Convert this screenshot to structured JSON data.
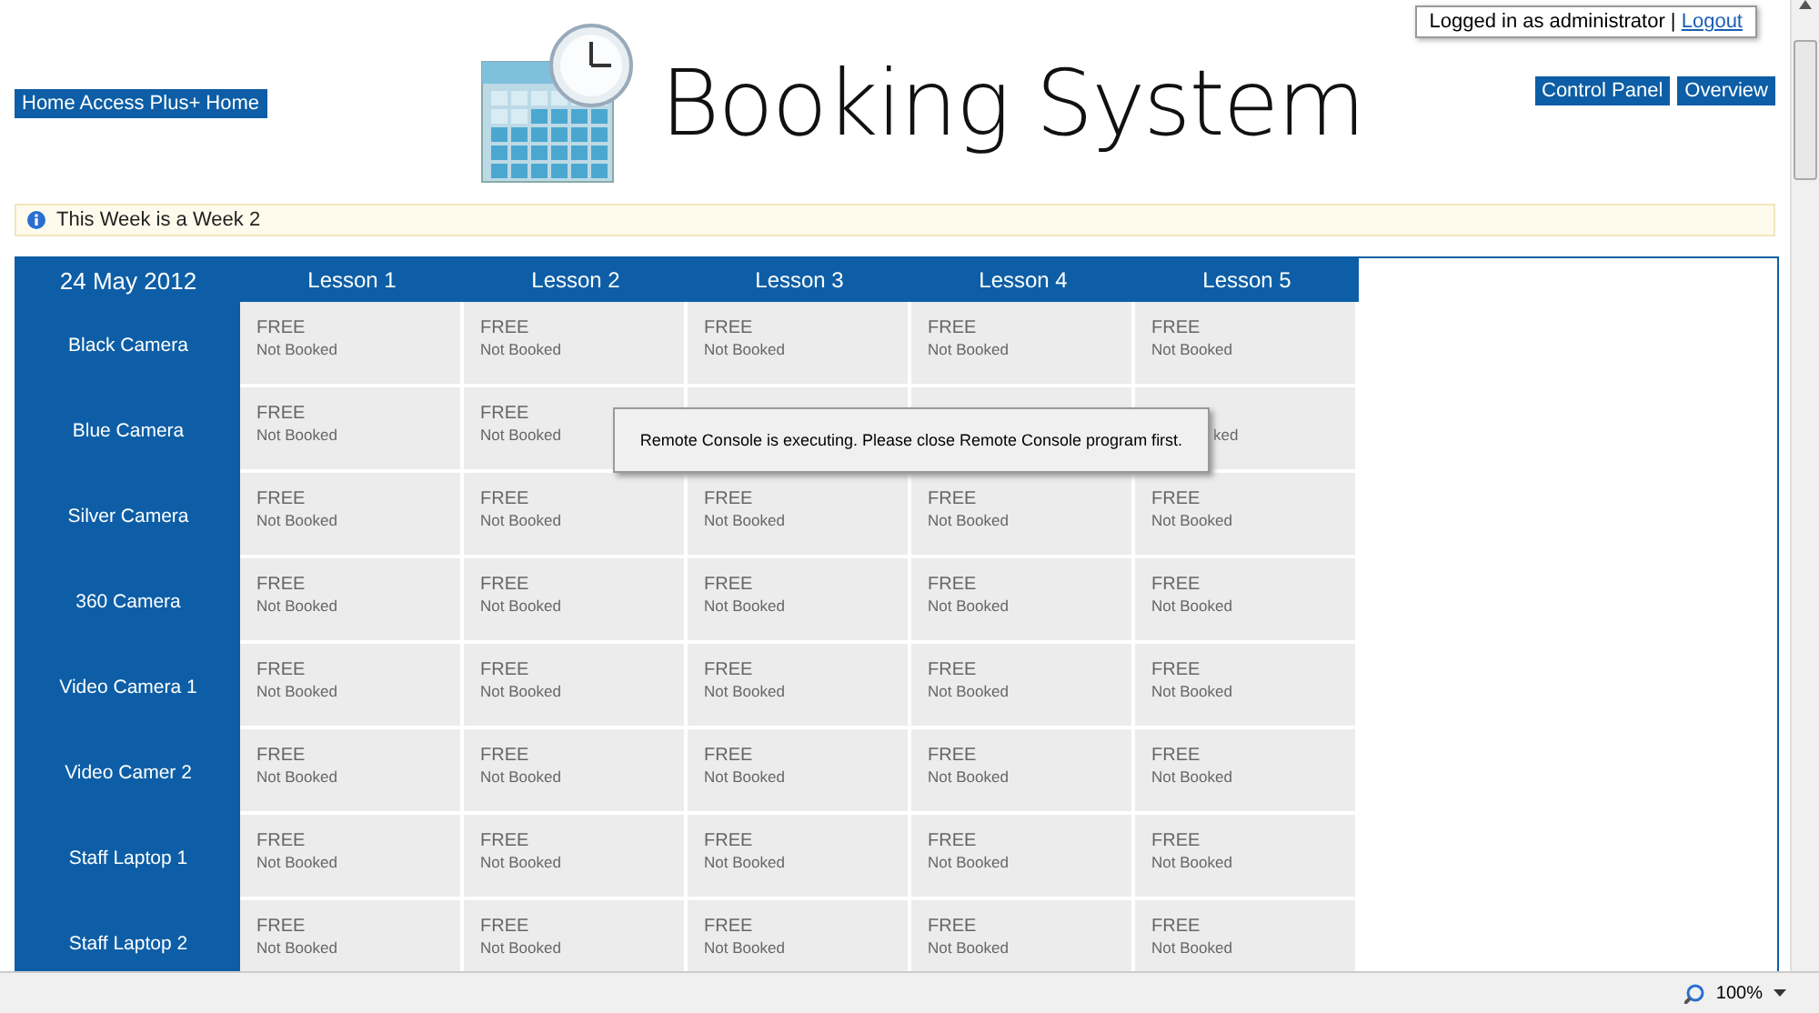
{
  "login": {
    "text": "Logged in as administrator |",
    "link": "Logout"
  },
  "nav_left": [
    "Home Access Plus+ Home"
  ],
  "title": "Booking System",
  "nav_right": [
    "Control Panel",
    "Overview"
  ],
  "notice": "This Week is a Week 2",
  "table": {
    "date": "24 May 2012",
    "columns": [
      "Lesson 1",
      "Lesson 2",
      "Lesson 3",
      "Lesson 4",
      "Lesson 5"
    ],
    "rows": [
      {
        "name": "Black Camera",
        "cells": [
          {
            "status": "FREE",
            "note": "Not Booked"
          },
          {
            "status": "FREE",
            "note": "Not Booked"
          },
          {
            "status": "FREE",
            "note": "Not Booked"
          },
          {
            "status": "FREE",
            "note": "Not Booked"
          },
          {
            "status": "FREE",
            "note": "Not Booked"
          }
        ]
      },
      {
        "name": "Blue Camera",
        "cells": [
          {
            "status": "FREE",
            "note": "Not Booked"
          },
          {
            "status": "FREE",
            "note": "Not Booked"
          },
          {
            "covered": true
          },
          {
            "covered": true
          },
          {
            "covered": true,
            "note": "ked"
          }
        ]
      },
      {
        "name": "Silver Camera",
        "cells": [
          {
            "status": "FREE",
            "note": "Not Booked"
          },
          {
            "status": "FREE",
            "note": "Not Booked"
          },
          {
            "status": "FREE",
            "note": "Not Booked"
          },
          {
            "status": "FREE",
            "note": "Not Booked"
          },
          {
            "status": "FREE",
            "note": "Not Booked"
          }
        ]
      },
      {
        "name": "360 Camera",
        "cells": [
          {
            "status": "FREE",
            "note": "Not Booked"
          },
          {
            "status": "FREE",
            "note": "Not Booked"
          },
          {
            "status": "FREE",
            "note": "Not Booked"
          },
          {
            "status": "FREE",
            "note": "Not Booked"
          },
          {
            "status": "FREE",
            "note": "Not Booked"
          }
        ]
      },
      {
        "name": "Video Camera 1",
        "cells": [
          {
            "status": "FREE",
            "note": "Not Booked"
          },
          {
            "status": "FREE",
            "note": "Not Booked"
          },
          {
            "status": "FREE",
            "note": "Not Booked"
          },
          {
            "status": "FREE",
            "note": "Not Booked"
          },
          {
            "status": "FREE",
            "note": "Not Booked"
          }
        ]
      },
      {
        "name": "Video Camer 2",
        "cells": [
          {
            "status": "FREE",
            "note": "Not Booked"
          },
          {
            "status": "FREE",
            "note": "Not Booked"
          },
          {
            "status": "FREE",
            "note": "Not Booked"
          },
          {
            "status": "FREE",
            "note": "Not Booked"
          },
          {
            "status": "FREE",
            "note": "Not Booked"
          }
        ]
      },
      {
        "name": "Staff Laptop 1",
        "cells": [
          {
            "status": "FREE",
            "note": "Not Booked"
          },
          {
            "status": "FREE",
            "note": "Not Booked"
          },
          {
            "status": "FREE",
            "note": "Not Booked"
          },
          {
            "status": "FREE",
            "note": "Not Booked"
          },
          {
            "status": "FREE",
            "note": "Not Booked"
          }
        ]
      },
      {
        "name": "Staff Laptop 2",
        "cells": [
          {
            "status": "FREE",
            "note": "Not Booked"
          },
          {
            "status": "FREE",
            "note": "Not Booked"
          },
          {
            "status": "FREE",
            "note": "Not Booked"
          },
          {
            "status": "FREE",
            "note": "Not Booked"
          },
          {
            "status": "FREE",
            "note": "Not Booked"
          }
        ]
      }
    ]
  },
  "popup": "Remote Console is executing. Please close Remote Console program first.",
  "zoom": "100%"
}
